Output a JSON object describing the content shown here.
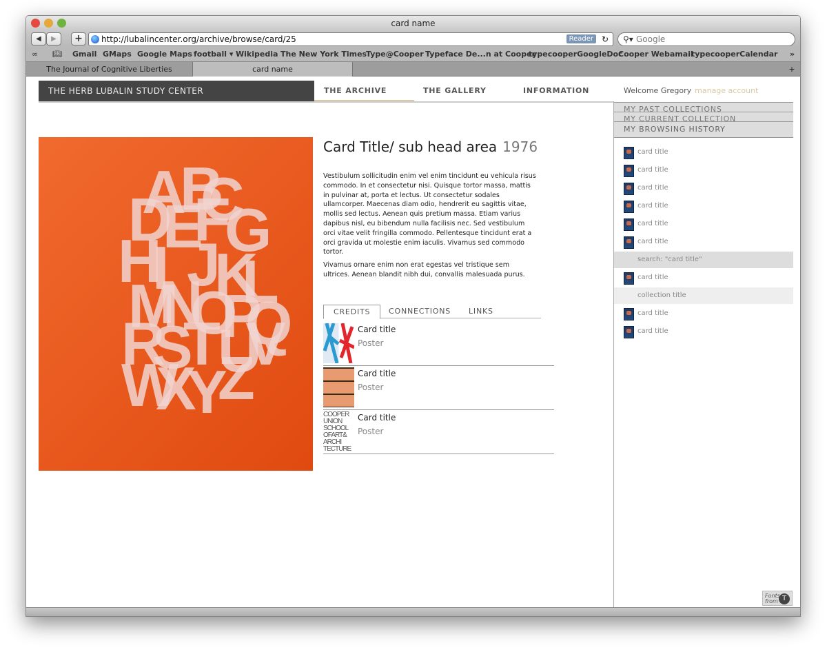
{
  "window": {
    "title": "card name"
  },
  "toolbar": {
    "url": "http://lubalincenter.org/archive/browse/card/25",
    "reader": "Reader",
    "search_placeholder": "Google"
  },
  "bookmarks": [
    "Gmail",
    "GMaps",
    "Google Maps",
    "football ▾",
    "Wikipedia",
    "The New York Times",
    "Type@Cooper",
    "Typeface De...n at Cooper",
    "typecooperGoogleDoc",
    "Cooper Webamail",
    "typecooperCalendar"
  ],
  "tabs": [
    "The Journal of Cognitive Liberties",
    "card name"
  ],
  "site": {
    "brand": "THE HERB LUBALIN STUDY CENTER",
    "nav": [
      "THE ARCHIVE",
      "THE GALLERY",
      "INFORMATION"
    ],
    "welcome": "Welcome Gregory",
    "manage": "manage account"
  },
  "sidebar": {
    "tabs": [
      "MY PAST COLLECTIONS",
      "MY CURRENT COLLECTION",
      "MY BROWSING HISTORY"
    ],
    "history": [
      {
        "label": "card title",
        "type": "card"
      },
      {
        "label": "card title",
        "type": "card"
      },
      {
        "label": "card title",
        "type": "card"
      },
      {
        "label": "card title",
        "type": "card"
      },
      {
        "label": "card title",
        "type": "card"
      },
      {
        "label": "card title",
        "type": "card"
      },
      {
        "label": "search: \"card title\"",
        "type": "search"
      },
      {
        "label": "card title",
        "type": "card"
      },
      {
        "label": "collection title",
        "type": "collection"
      },
      {
        "label": "card title",
        "type": "card"
      },
      {
        "label": "card title",
        "type": "card"
      }
    ]
  },
  "card": {
    "title": "Card Title/ sub head area",
    "year": "1976",
    "paragraphs": [
      "Vestibulum sollicitudin enim vel enim tincidunt eu vehicula risus commodo. In et consectetur nisi. Quisque tortor massa, mattis in pulvinar at, porta et lectus. Ut consectetur sodales ullamcorper. Maecenas diam odio, hendrerit eu sagittis vitae, mollis sed lectus. Aenean quis pretium massa. Etiam varius dapibus nisl, eu bibendum nulla facilisis nec. Sed vestibulum orci vitae velit fringilla commodo. Pellentesque tincidunt erat a orci gravida ut molestie enim iaculis. Vivamus sed commodo tortor.",
      "Vivamus ornare enim non erat egestas vel tristique sem ultrices. Aenean blandit nibh dui, convallis malesuada purus."
    ],
    "tabs": [
      "CREDITS",
      "CONNECTIONS",
      "LINKS"
    ],
    "credits": [
      {
        "title": "Card title",
        "type": "Poster"
      },
      {
        "title": "Card title",
        "type": "Poster"
      },
      {
        "title": "Card title",
        "type": "Poster"
      }
    ]
  },
  "poster_letters": "ABCDEFGHIJKLMNOPQRSTUVWXYZ",
  "footer": {
    "fonts": "Fonts from"
  }
}
